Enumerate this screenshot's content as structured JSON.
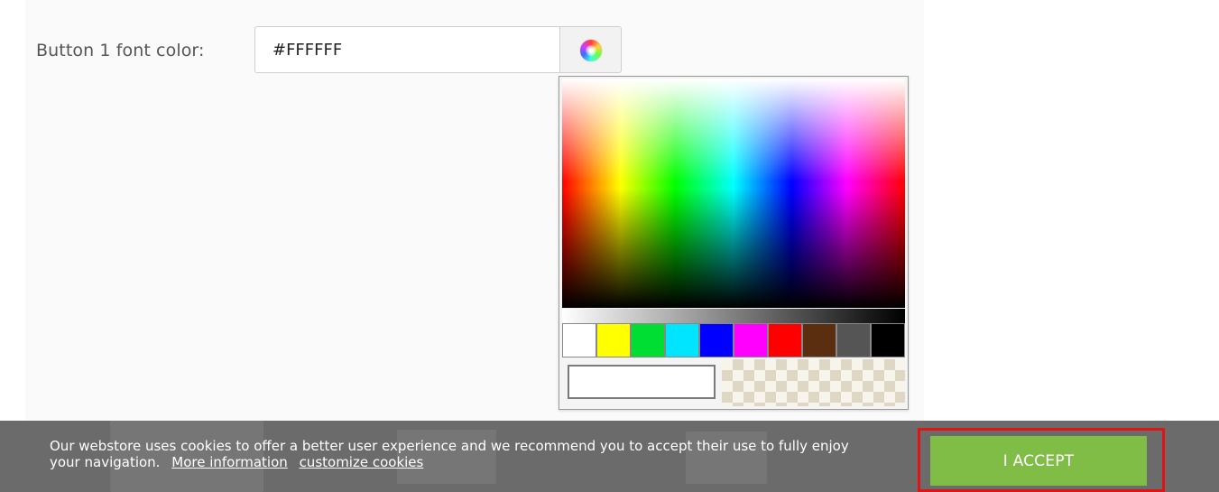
{
  "settings": {
    "field_label": "Button 1 font color:",
    "color_value": "#FFFFFF",
    "picker_button_icon": "color-wheel-icon"
  },
  "color_picker": {
    "swatches": [
      "#ffffff",
      "#ffff00",
      "#00dd33",
      "#00e5ff",
      "#0000ff",
      "#ff00ff",
      "#ff0000",
      "#5c2e10",
      "#555555",
      "#000000"
    ],
    "preview_color": "#ffffff"
  },
  "cookie_banner": {
    "message_line1": "Our webstore uses cookies to offer a better user experience and we recommend you to accept their use to fully enjoy",
    "message_line2": "your navigation.",
    "more_info_link": "More information",
    "customize_link": "customize cookies",
    "accept_button": "I ACCEPT",
    "background_color": "#6b6b6b",
    "accept_color": "#7fbd47",
    "highlight_color": "#e01414"
  }
}
